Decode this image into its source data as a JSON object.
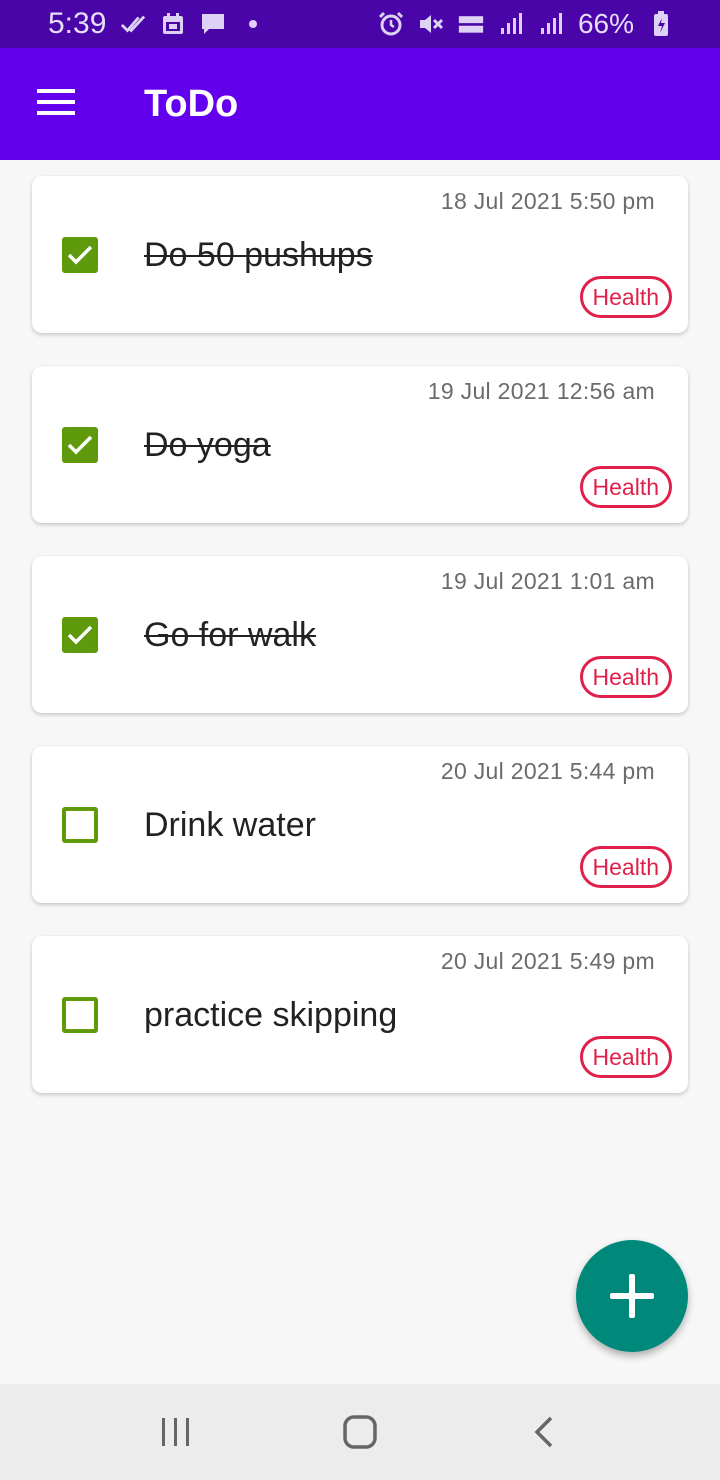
{
  "status_bar": {
    "time": "5:39",
    "battery_percent": "66%",
    "left_icons": [
      "double-check-icon",
      "calendar-icon",
      "message-icon",
      "dot-icon"
    ],
    "right_icons": [
      "alarm-icon",
      "mute-icon",
      "volte-icon",
      "signal-icon",
      "signal-icon",
      "battery-icon"
    ]
  },
  "app_bar": {
    "title": "ToDo",
    "color": "#6200ee"
  },
  "tasks": [
    {
      "title": "Do 50 pushups",
      "date": "18 Jul 2021 5:50 pm",
      "tag": "Health",
      "done": true
    },
    {
      "title": "Do yoga",
      "date": "19 Jul 2021 12:56 am",
      "tag": "Health",
      "done": true
    },
    {
      "title": "Go for walk",
      "date": "19 Jul 2021 1:01 am",
      "tag": "Health",
      "done": true
    },
    {
      "title": "Drink water",
      "date": "20 Jul 2021 5:44 pm",
      "tag": "Health",
      "done": false
    },
    {
      "title": "practice skipping",
      "date": "20 Jul 2021 5:49 pm",
      "tag": "Health",
      "done": false
    }
  ],
  "colors": {
    "checkbox": "#5e9a0b",
    "tag": "#e0204a",
    "fab": "#00897b"
  },
  "fab": {
    "icon": "plus-icon"
  },
  "nav_bar": {
    "icons": [
      "recent-apps-icon",
      "home-icon",
      "back-icon"
    ]
  }
}
